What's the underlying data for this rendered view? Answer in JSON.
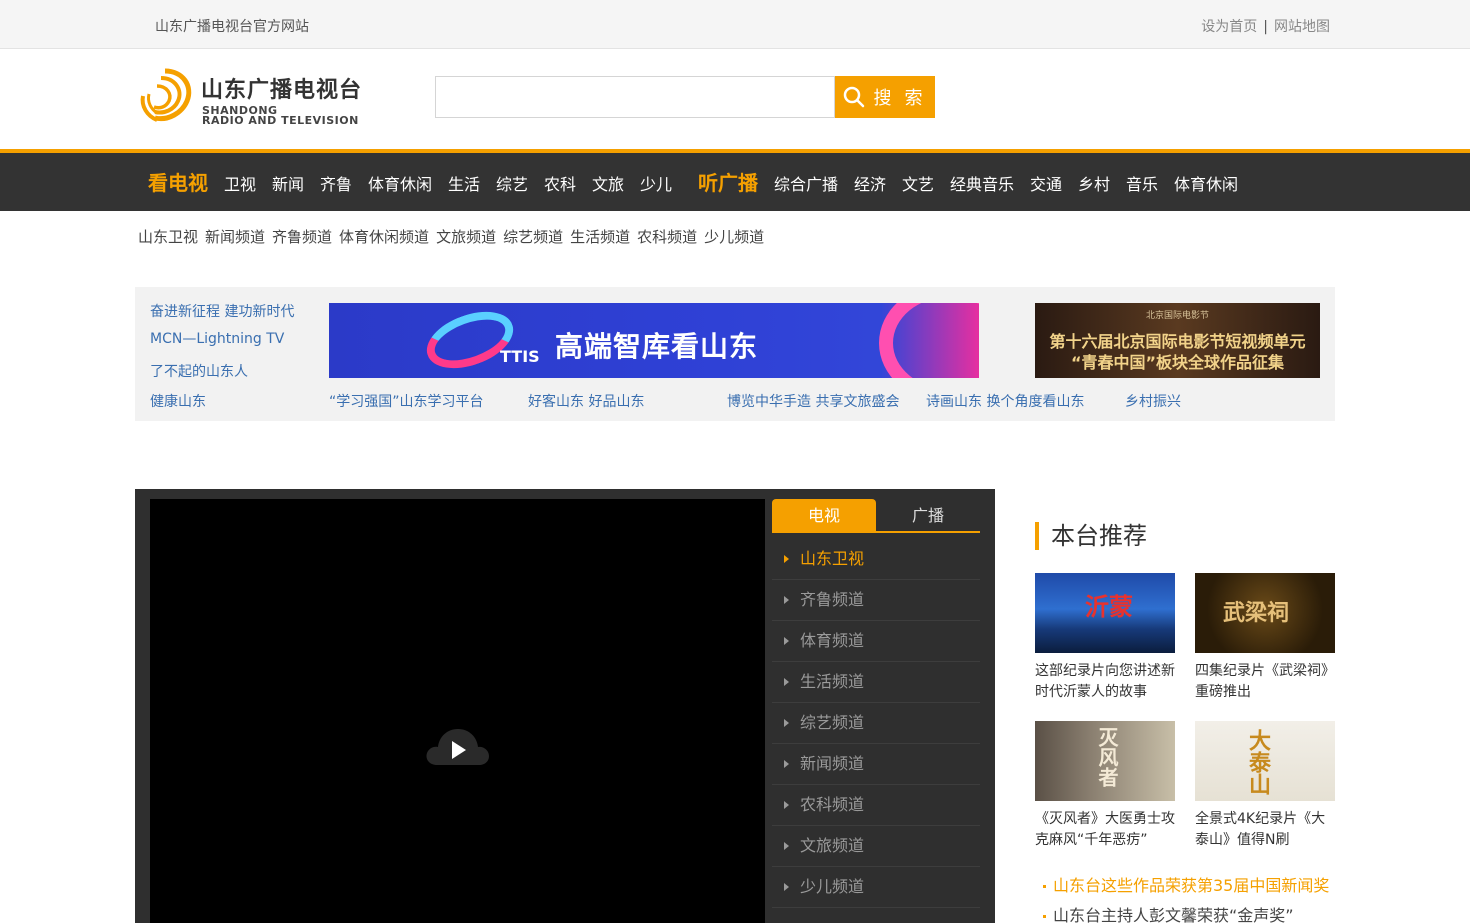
{
  "topbar": {
    "site_name": "山东广播电视台官方网站",
    "set_home": "设为首页",
    "separator": "|",
    "sitemap": "网站地图"
  },
  "logo": {
    "cn": "山东广播电视台",
    "en_line1": "SHANDONG",
    "en_line2": "RADIO AND TELEVISION"
  },
  "search": {
    "placeholder": "",
    "button_label": "搜 索"
  },
  "nav": {
    "tv_head": "看电视",
    "tv_items": [
      "卫视",
      "新闻",
      "齐鲁",
      "体育休闲",
      "生活",
      "综艺",
      "农科",
      "文旅",
      "少儿"
    ],
    "radio_head": "听广播",
    "radio_items": [
      "综合广播",
      "经济",
      "文艺",
      "经典音乐",
      "交通",
      "乡村",
      "音乐",
      "体育休闲"
    ]
  },
  "subnav": [
    "山东卫视",
    "新闻频道",
    "齐鲁频道",
    "体育休闲频道",
    "文旅频道",
    "综艺频道",
    "生活频道",
    "农科频道",
    "少儿频道"
  ],
  "promo": {
    "side_links": [
      "奋进新征程 建功新时代",
      "MCN—Lightning TV",
      "了不起的山东人",
      "健康山东"
    ],
    "bottom_links": [
      "“学习强国”山东学习平台",
      "好客山东 好品山东",
      "博览中华手造 共享文旅盛会",
      "诗画山东 换个角度看山东",
      "乡村振兴"
    ],
    "banner_main_text": "高端智库看山东",
    "banner_main_tag": "TTIS",
    "banner_side_top": "北京国际电影节",
    "banner_side_line1": "第十六届北京国际电影节短视频单元",
    "banner_side_line2": "“青春中国”板块全球作品征集"
  },
  "player": {
    "tabs": [
      "电视",
      "广播"
    ],
    "channels": [
      "山东卫视",
      "齐鲁频道",
      "体育频道",
      "生活频道",
      "综艺频道",
      "新闻频道",
      "农科频道",
      "文旅频道",
      "少儿频道"
    ]
  },
  "recommend": {
    "title": "本台推荐",
    "cards": [
      {
        "caption": "这部纪录片向您讲述新时代沂蒙人的故事",
        "thumb_text": "沂蒙"
      },
      {
        "caption": "四集纪录片《武梁祠》重磅推出",
        "thumb_text": "武梁祠"
      },
      {
        "caption": "《灭风者》大医勇士攻克麻风“千年恶疠”",
        "thumb_text": "灭风者"
      },
      {
        "caption": "全景式4K纪录片《大泰山》值得N刷",
        "thumb_text": "大泰山"
      }
    ],
    "news": [
      "山东台这些作品荣获第35届中国新闻奖",
      "山东台主持人彭文馨荣获“金声奖”"
    ]
  },
  "colors": {
    "accent": "#f5a000",
    "nav_bg": "#333333",
    "link_blue": "#3a6fb0"
  }
}
